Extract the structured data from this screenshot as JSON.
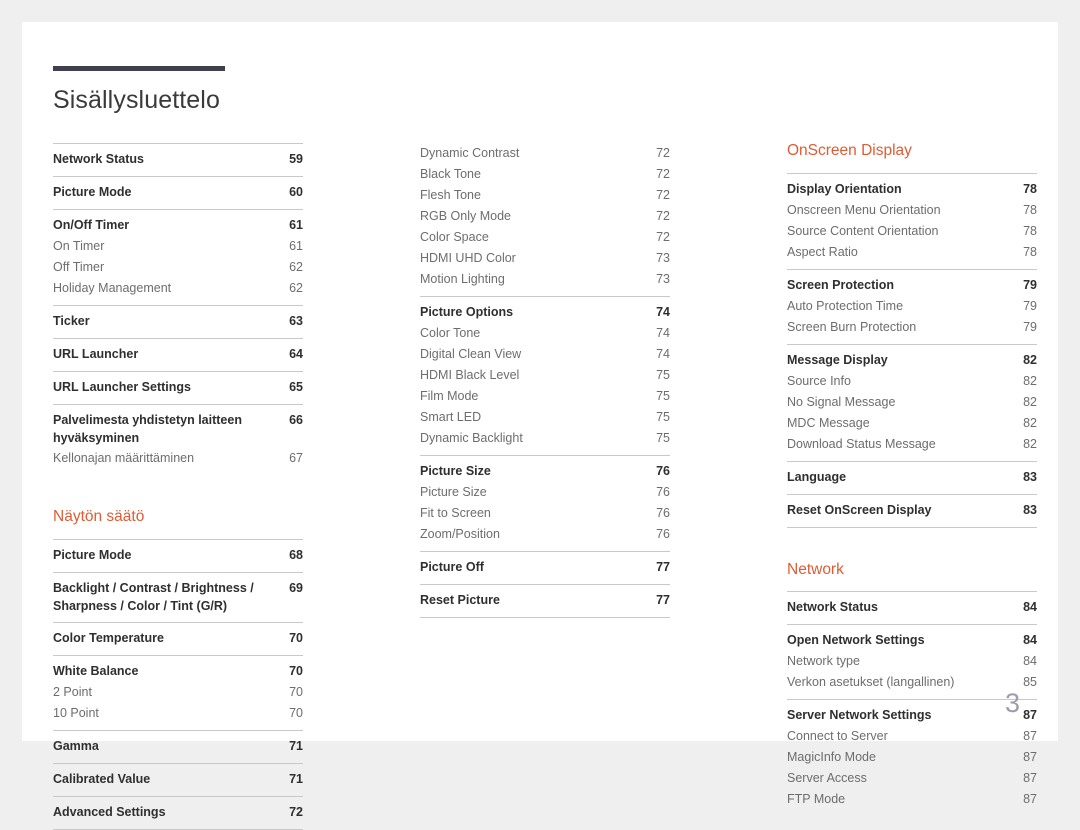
{
  "document": {
    "title": "Sisällysluettelo",
    "page_number": "3",
    "accent_color": "#dd5c35",
    "rule_color": "#3f3f50"
  },
  "columns": [
    {
      "id": "column-left",
      "blocks": [
        {
          "type": "group",
          "rule_above": true,
          "rows": [
            {
              "style": "main",
              "label": "Network Status",
              "page": "59"
            }
          ]
        },
        {
          "type": "group",
          "rule_above": true,
          "rows": [
            {
              "style": "main",
              "label": "Picture Mode",
              "page": "60"
            }
          ]
        },
        {
          "type": "group",
          "rule_above": true,
          "rows": [
            {
              "style": "main",
              "label": "On/Off Timer",
              "page": "61"
            },
            {
              "style": "sub",
              "label": "On Timer",
              "page": "61"
            },
            {
              "style": "sub",
              "label": "Off Timer",
              "page": "62"
            },
            {
              "style": "sub",
              "label": "Holiday Management",
              "page": "62"
            }
          ]
        },
        {
          "type": "group",
          "rule_above": true,
          "rows": [
            {
              "style": "main",
              "label": "Ticker",
              "page": "63"
            }
          ]
        },
        {
          "type": "group",
          "rule_above": true,
          "rows": [
            {
              "style": "main",
              "label": "URL Launcher",
              "page": "64"
            }
          ]
        },
        {
          "type": "group",
          "rule_above": true,
          "rows": [
            {
              "style": "main",
              "label": "URL Launcher Settings",
              "page": "65"
            }
          ]
        },
        {
          "type": "group",
          "rule_above": true,
          "rows": [
            {
              "style": "main",
              "wrap": true,
              "label": "Palvelimesta yhdistetyn laitteen hyväksyminen",
              "page": "66"
            },
            {
              "style": "sub",
              "label": "Kellonajan määrittäminen",
              "page": "67"
            }
          ]
        },
        {
          "type": "heading",
          "label": "Näytön säätö",
          "spaced": true
        },
        {
          "type": "group",
          "rule_above": true,
          "rows": [
            {
              "style": "main",
              "label": "Picture Mode",
              "page": "68"
            }
          ]
        },
        {
          "type": "group",
          "rule_above": true,
          "rows": [
            {
              "style": "main",
              "wrap": true,
              "label": "Backlight / Contrast / Brightness / Sharpness / Color / Tint (G/R)",
              "page": "69"
            }
          ]
        },
        {
          "type": "group",
          "rule_above": true,
          "rows": [
            {
              "style": "main",
              "label": "Color Temperature",
              "page": "70"
            }
          ]
        },
        {
          "type": "group",
          "rule_above": true,
          "rows": [
            {
              "style": "main",
              "label": "White Balance",
              "page": "70"
            },
            {
              "style": "sub",
              "label": "2 Point",
              "page": "70"
            },
            {
              "style": "sub",
              "label": "10 Point",
              "page": "70"
            }
          ]
        },
        {
          "type": "group",
          "rule_above": true,
          "rows": [
            {
              "style": "main",
              "label": "Gamma",
              "page": "71"
            }
          ]
        },
        {
          "type": "group",
          "rule_above": true,
          "rows": [
            {
              "style": "main",
              "label": "Calibrated Value",
              "page": "71"
            }
          ]
        },
        {
          "type": "group",
          "rule_above": true,
          "last": true,
          "rows": [
            {
              "style": "main",
              "label": "Advanced Settings",
              "page": "72"
            }
          ]
        }
      ]
    },
    {
      "id": "column-middle",
      "blocks": [
        {
          "type": "group",
          "rule_above": false,
          "rows": [
            {
              "style": "sub",
              "label": "Dynamic Contrast",
              "page": "72"
            },
            {
              "style": "sub",
              "label": "Black Tone",
              "page": "72"
            },
            {
              "style": "sub",
              "label": "Flesh Tone",
              "page": "72"
            },
            {
              "style": "sub",
              "label": "RGB Only Mode",
              "page": "72"
            },
            {
              "style": "sub",
              "label": "Color Space",
              "page": "72"
            },
            {
              "style": "sub",
              "label": "HDMI UHD Color",
              "page": "73"
            },
            {
              "style": "sub",
              "label": "Motion Lighting",
              "page": "73"
            }
          ]
        },
        {
          "type": "group",
          "rule_above": true,
          "rows": [
            {
              "style": "main",
              "label": "Picture Options",
              "page": "74"
            },
            {
              "style": "sub",
              "label": "Color Tone",
              "page": "74"
            },
            {
              "style": "sub",
              "label": "Digital Clean View",
              "page": "74"
            },
            {
              "style": "sub",
              "label": "HDMI Black Level",
              "page": "75"
            },
            {
              "style": "sub",
              "label": "Film Mode",
              "page": "75"
            },
            {
              "style": "sub",
              "label": "Smart LED",
              "page": "75"
            },
            {
              "style": "sub",
              "label": "Dynamic Backlight",
              "page": "75"
            }
          ]
        },
        {
          "type": "group",
          "rule_above": true,
          "rows": [
            {
              "style": "main",
              "label": "Picture Size",
              "page": "76"
            },
            {
              "style": "sub",
              "label": "Picture Size",
              "page": "76"
            },
            {
              "style": "sub",
              "label": "Fit to Screen",
              "page": "76"
            },
            {
              "style": "sub",
              "label": "Zoom/Position",
              "page": "76"
            }
          ]
        },
        {
          "type": "group",
          "rule_above": true,
          "rows": [
            {
              "style": "main",
              "label": "Picture Off",
              "page": "77"
            }
          ]
        },
        {
          "type": "group",
          "rule_above": true,
          "last": true,
          "rows": [
            {
              "style": "main",
              "label": "Reset Picture",
              "page": "77"
            }
          ]
        }
      ]
    },
    {
      "id": "column-right",
      "blocks": [
        {
          "type": "heading",
          "label": "OnScreen Display",
          "spaced": false
        },
        {
          "type": "group",
          "rule_above": true,
          "rows": [
            {
              "style": "main",
              "label": "Display Orientation",
              "page": "78"
            },
            {
              "style": "sub",
              "label": "Onscreen Menu Orientation",
              "page": "78"
            },
            {
              "style": "sub",
              "label": "Source Content Orientation",
              "page": "78"
            },
            {
              "style": "sub",
              "label": "Aspect Ratio",
              "page": "78"
            }
          ]
        },
        {
          "type": "group",
          "rule_above": true,
          "rows": [
            {
              "style": "main",
              "label": "Screen Protection",
              "page": "79"
            },
            {
              "style": "sub",
              "label": "Auto Protection Time",
              "page": "79"
            },
            {
              "style": "sub",
              "label": "Screen Burn Protection",
              "page": "79"
            }
          ]
        },
        {
          "type": "group",
          "rule_above": true,
          "rows": [
            {
              "style": "main",
              "label": "Message Display",
              "page": "82"
            },
            {
              "style": "sub",
              "label": "Source Info",
              "page": "82"
            },
            {
              "style": "sub",
              "label": "No Signal Message",
              "page": "82"
            },
            {
              "style": "sub",
              "label": "MDC Message",
              "page": "82"
            },
            {
              "style": "sub",
              "label": "Download Status Message",
              "page": "82"
            }
          ]
        },
        {
          "type": "group",
          "rule_above": true,
          "rows": [
            {
              "style": "main",
              "label": "Language",
              "page": "83"
            }
          ]
        },
        {
          "type": "group",
          "rule_above": true,
          "last": true,
          "rows": [
            {
              "style": "main",
              "label": "Reset OnScreen Display",
              "page": "83"
            }
          ]
        },
        {
          "type": "heading",
          "label": "Network",
          "spaced": true
        },
        {
          "type": "group",
          "rule_above": true,
          "rows": [
            {
              "style": "main",
              "label": "Network Status",
              "page": "84"
            }
          ]
        },
        {
          "type": "group",
          "rule_above": true,
          "rows": [
            {
              "style": "main",
              "label": "Open Network Settings",
              "page": "84"
            },
            {
              "style": "sub",
              "label": "Network type",
              "page": "84"
            },
            {
              "style": "sub",
              "label": "Verkon asetukset (langallinen)",
              "page": "85"
            }
          ]
        },
        {
          "type": "group",
          "rule_above": true,
          "rows": [
            {
              "style": "main",
              "label": "Server Network Settings",
              "page": "87"
            },
            {
              "style": "sub",
              "label": "Connect to Server",
              "page": "87"
            },
            {
              "style": "sub",
              "label": "MagicInfo Mode",
              "page": "87"
            },
            {
              "style": "sub",
              "label": "Server Access",
              "page": "87"
            },
            {
              "style": "sub",
              "label": "FTP Mode",
              "page": "87"
            }
          ]
        }
      ]
    }
  ]
}
